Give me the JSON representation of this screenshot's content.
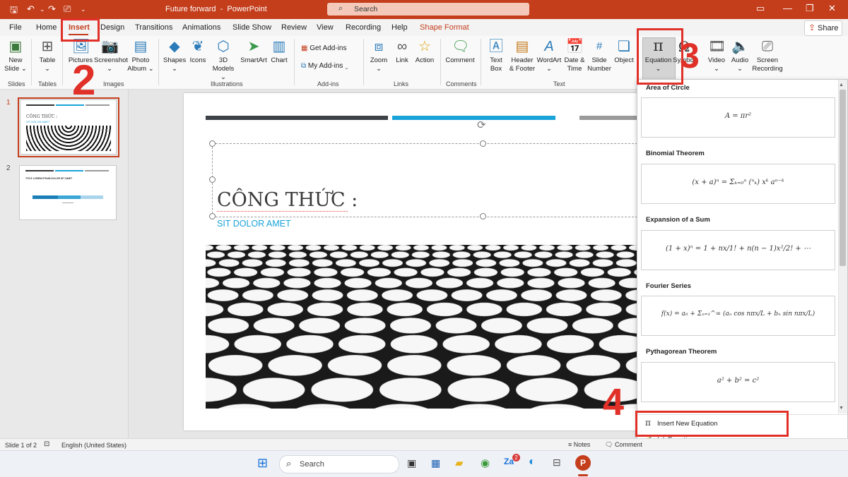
{
  "window": {
    "doc_title": "Future forward",
    "app_name": "PowerPoint",
    "search_placeholder": "Search"
  },
  "tabs": {
    "file": "File",
    "home": "Home",
    "insert": "Insert",
    "design": "Design",
    "transitions": "Transitions",
    "animations": "Animations",
    "slideshow": "Slide Show",
    "review": "Review",
    "view": "View",
    "recording": "Recording",
    "help": "Help",
    "shapeformat": "Shape Format",
    "share": "Share"
  },
  "ribbon": {
    "newslide": [
      "New",
      "Slide ⌄"
    ],
    "table": [
      "Table",
      "⌄"
    ],
    "pictures": [
      "Pictures",
      "⌄"
    ],
    "screenshot": [
      "Screenshot",
      "⌄"
    ],
    "photoalbum": [
      "Photo",
      "Album ⌄"
    ],
    "shapes": [
      "Shapes",
      "⌄"
    ],
    "icons": "Icons",
    "models3d": [
      "3D",
      "Models ⌄"
    ],
    "smartart": "SmartArt",
    "chart": "Chart",
    "getaddins": "Get Add-ins",
    "myaddins": "My Add-ins",
    "zoom": [
      "Zoom",
      "⌄"
    ],
    "link": "Link",
    "action": "Action",
    "comment": "Comment",
    "textbox": [
      "Text",
      "Box"
    ],
    "headerfooter": [
      "Header",
      "& Footer"
    ],
    "wordart": [
      "WordArt",
      "⌄"
    ],
    "datetime": [
      "Date &",
      "Time"
    ],
    "slidenumber": [
      "Slide",
      "Number"
    ],
    "object": "Object",
    "equation": [
      "Equation",
      "⌄"
    ],
    "symbol": "Symbol",
    "video": [
      "Video",
      "⌄"
    ],
    "audio": [
      "Audio",
      "⌄"
    ],
    "screenrecording": [
      "Screen",
      "Recording"
    ],
    "groups": {
      "slides": "Slides",
      "tables": "Tables",
      "images": "Images",
      "illustrations": "Illustrations",
      "addins": "Add-ins",
      "links": "Links",
      "comments": "Comments",
      "text": "Text"
    }
  },
  "thumbnails": [
    {
      "number": "1",
      "title": "CÔNG THỨC :",
      "subtitle": "SIT DOLOR AMET"
    },
    {
      "number": "2",
      "title": "TITLE LOREM IPSUM DOLOR SIT AMET"
    }
  ],
  "slide": {
    "title": "CÔNG THỨC :",
    "subtitle": "SIT DOLOR AMET"
  },
  "equation_menu": {
    "items": [
      {
        "name": "Area of Circle",
        "formula": "A = πr²"
      },
      {
        "name": "Binomial Theorem",
        "formula": "(x + a)ⁿ = Σₖ₌₀ⁿ (ⁿₖ) xᵏ aⁿ⁻ᵏ"
      },
      {
        "name": "Expansion of a Sum",
        "formula": "(1 + x)ⁿ = 1 + nx/1! + n(n − 1)x²/2! + ⋯"
      },
      {
        "name": "Fourier Series",
        "formula": "f(x) = a₀ + Σₙ₌₁^∞ (aₙ cos nπx/L + bₙ sin nπx/L)"
      },
      {
        "name": "Pythagorean Theorem",
        "formula": "a² + b² = c²"
      }
    ],
    "insert_new": "Insert New Equation",
    "ink_equation": "Ink Equation"
  },
  "status": {
    "slide_count": "Slide 1 of 2",
    "language": "English (United States)",
    "notes": "Notes",
    "comments": "Comment"
  },
  "taskbar": {
    "search": "Search",
    "badge": "2"
  },
  "annotations": [
    "2",
    "3",
    "4"
  ],
  "colors": {
    "accent": "#c43e1c",
    "annotation": "#e03028",
    "slide_blue": "#1aa3d9"
  }
}
